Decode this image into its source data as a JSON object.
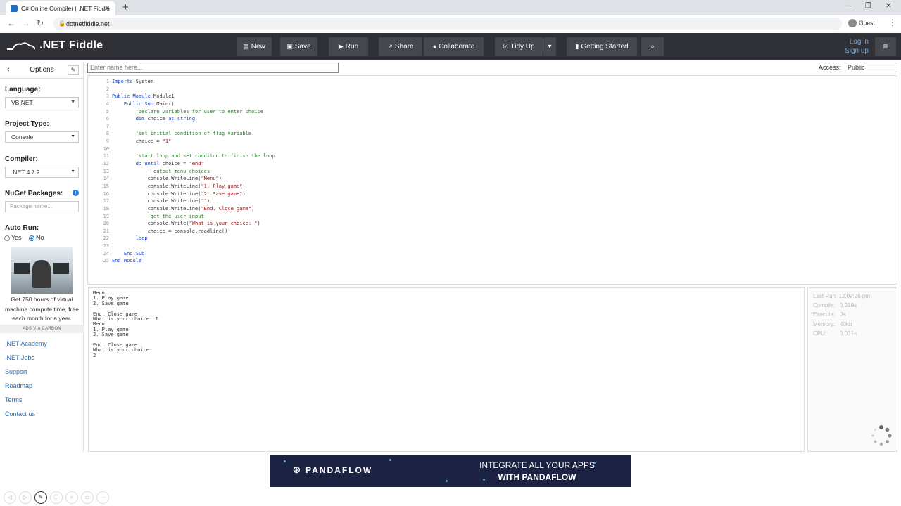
{
  "browser": {
    "tab_title": "C# Online Compiler | .NET Fiddle",
    "url": "dotnetfiddle.net",
    "profile": "Guest"
  },
  "header": {
    "logo_text": ".NET Fiddle",
    "buttons": {
      "new": "New",
      "save": "Save",
      "run": "Run",
      "share": "Share",
      "collaborate": "Collaborate",
      "tidy": "Tidy Up",
      "getting_started": "Getting Started"
    },
    "login": "Log in",
    "signup": "Sign up"
  },
  "sidebar": {
    "title": "Options",
    "language_label": "Language:",
    "language_value": "VB.NET",
    "project_type_label": "Project Type:",
    "project_type_value": "Console",
    "compiler_label": "Compiler:",
    "compiler_value": ".NET 4.7.2",
    "nuget_label": "NuGet Packages:",
    "nuget_placeholder": "Package name...",
    "auto_run_label": "Auto Run:",
    "auto_run_yes": "Yes",
    "auto_run_no": "No",
    "auto_run_selected": "No",
    "ad_text": "Get 750 hours of virtual machine compute time, free each month for a year.",
    "ads_via": "ADS VIA CARBON",
    "links": [
      ".NET Academy",
      ".NET Jobs",
      "Support",
      "Roadmap",
      "Terms",
      "Contact us"
    ]
  },
  "editor": {
    "name_placeholder": "Enter name here...",
    "access_label": "Access:",
    "access_value": "Public",
    "line_numbers": [
      "1",
      "2",
      "3",
      "4",
      "5",
      "6",
      "7",
      "8",
      "9",
      "10",
      "11",
      "12",
      "13",
      "14",
      "15",
      "16",
      "17",
      "18",
      "19",
      "20",
      "21",
      "22",
      "23",
      "24",
      "25"
    ],
    "lines": [
      "Imports System",
      "",
      "Public Module Module1",
      "    Public Sub Main()",
      "        'declare variables for user to enter choice",
      "        dim choice as string",
      "",
      "        'set initial condition of flag variable.",
      "        choice = \"1\"",
      "",
      "        'start loop and set conditon to finish the loop",
      "        do until choice = \"end\"",
      "            ' output menu choices",
      "            console.WriteLine(\"Menu\")",
      "            console.WriteLine(\"1. Play game\")",
      "            console.WriteLine(\"2. Save game\")",
      "            console.WriteLine(\"\")",
      "            console.WriteLine(\"End. Close game\")",
      "            'get the user input",
      "            console.Write(\"What is your choice: \")",
      "            choice = console.readline()",
      "        loop",
      "",
      "    End Sub",
      "End Module"
    ]
  },
  "output": {
    "text": "Menu\n1. Play game\n2. Save game\n\nEnd. Close game\nWhat is your choice: 1\nMenu\n1. Play game\n2. Save game\n\nEnd. Close game\nWhat is your choice:\n2"
  },
  "stats": {
    "last_run_label": "Last Run:",
    "last_run": "12:09:26 pm",
    "compile_label": "Compile:",
    "compile": "0.219s",
    "execute_label": "Execute:",
    "execute": "0s",
    "memory_label": "Memory:",
    "memory": "40kb",
    "cpu_label": "CPU:",
    "cpu": "0.031s"
  },
  "banner": {
    "brand": "PANDAFLOW",
    "tagline_1": "INTEGRATE ALL YOUR APPS",
    "tagline_2": "WITH PANDAFLOW"
  }
}
